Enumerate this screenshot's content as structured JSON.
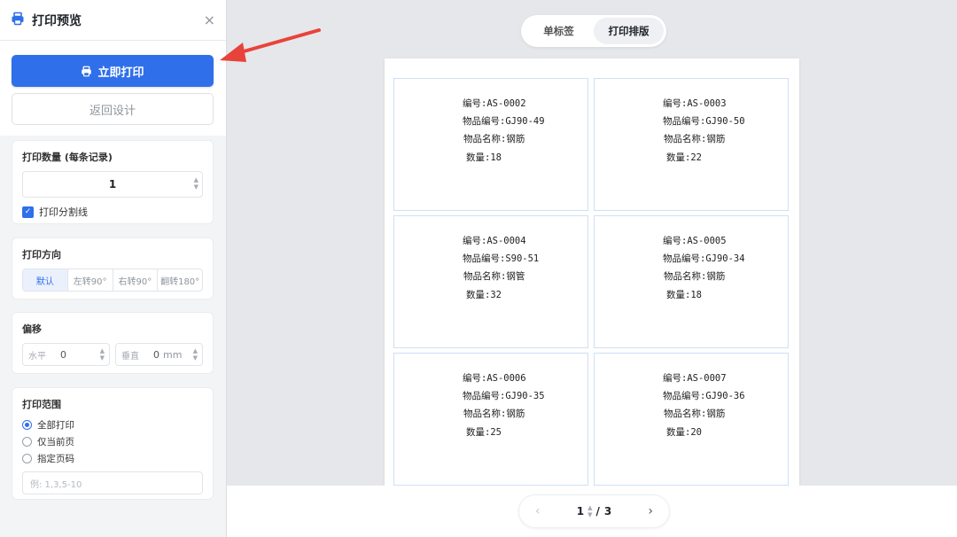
{
  "header": {
    "title": "打印预览",
    "close_icon": "×"
  },
  "actions": {
    "print_label": "立即打印",
    "back_label": "返回设计"
  },
  "quantity": {
    "title": "打印数量 (每条记录)",
    "value": "1",
    "divider_label": "打印分割线",
    "divider_checked": true
  },
  "direction": {
    "title": "打印方向",
    "options": [
      "默认",
      "左转90°",
      "右转90°",
      "翻转180°"
    ],
    "selected": "默认"
  },
  "offset": {
    "title": "偏移",
    "h_label": "水平",
    "h_value": "0",
    "v_label": "垂直",
    "v_value": "0",
    "unit": "mm"
  },
  "range": {
    "title": "打印范围",
    "options": [
      "全部打印",
      "仅当前页",
      "指定页码"
    ],
    "selected": "全部打印",
    "placeholder": "例: 1,3,5-10"
  },
  "mode_tabs": {
    "single": "单标签",
    "layout": "打印排版",
    "active": "打印排版"
  },
  "labels": [
    {
      "code": "编号:AS-0002",
      "item_no": "物品编号:GJ90-49",
      "name": "物品名称:钢筋",
      "qty": "数量:18"
    },
    {
      "code": "编号:AS-0003",
      "item_no": "物品编号:GJ90-50",
      "name": "物品名称:钢筋",
      "qty": "数量:22"
    },
    {
      "code": "编号:AS-0004",
      "item_no": "物品编号:S90-51",
      "name": "物品名称:钢管",
      "qty": "数量:32"
    },
    {
      "code": "编号:AS-0005",
      "item_no": "物品编号:GJ90-34",
      "name": "物品名称:钢筋",
      "qty": "数量:18"
    },
    {
      "code": "编号:AS-0006",
      "item_no": "物品编号:GJ90-35",
      "name": "物品名称:钢筋",
      "qty": "数量:25"
    },
    {
      "code": "编号:AS-0007",
      "item_no": "物品编号:GJ90-36",
      "name": "物品名称:钢筋",
      "qty": "数量:20"
    }
  ],
  "pager": {
    "current": "1",
    "separator": "/",
    "total": "3"
  },
  "colors": {
    "primary": "#2f6fea",
    "annotation_arrow": "#e8433a"
  }
}
